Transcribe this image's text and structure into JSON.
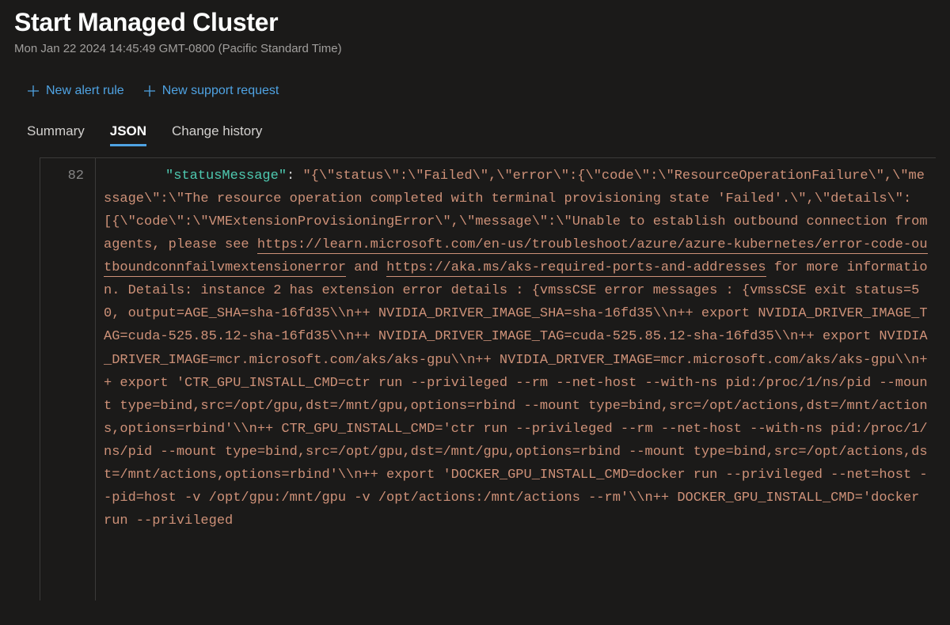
{
  "header": {
    "title": "Start Managed Cluster",
    "subtitle": "Mon Jan 22 2024 14:45:49 GMT-0800 (Pacific Standard Time)"
  },
  "commands": {
    "new_alert_rule": "New alert rule",
    "new_support_request": "New support request"
  },
  "tabs": {
    "summary": "Summary",
    "json": "JSON",
    "change_history": "Change history"
  },
  "json_view": {
    "line_number": "82",
    "key_label": "\"statusMessage\"",
    "value_prefix": ": ",
    "value_part1": "\"{\\\"status\\\":\\\"Failed\\\",\\\"error\\\":{\\\"code\\\":\\\"ResourceOperationFailure\\\",\\\"message\\\":\\\"The resource operation completed with terminal provisioning state 'Failed'.\\\",\\\"details\\\":[{\\\"code\\\":\\\"VMExtensionProvisioningError\\\",\\\"message\\\":\\\"Unable to establish outbound connection from agents, please see ",
    "link1_text": "https://learn.microsoft.com/en-us/troubleshoot/azure/azure-kubernetes/error-code-outboundconnfailvmextensionerror",
    "mid1": " and ",
    "link2_text": "https://aka.ms/aks-required-ports-and-addresses",
    "value_part2": " for more information. Details: instance 2 has extension error details : {vmssCSE error messages : {vmssCSE exit status=50, output=AGE_SHA=sha-16fd35\\\\n++ NVIDIA_DRIVER_IMAGE_SHA=sha-16fd35\\\\n++ export NVIDIA_DRIVER_IMAGE_TAG=cuda-525.85.12-sha-16fd35\\\\n++ NVIDIA_DRIVER_IMAGE_TAG=cuda-525.85.12-sha-16fd35\\\\n++ export NVIDIA_DRIVER_IMAGE=mcr.microsoft.com/aks/aks-gpu\\\\n++ NVIDIA_DRIVER_IMAGE=mcr.microsoft.com/aks/aks-gpu\\\\n++ export 'CTR_GPU_INSTALL_CMD=ctr run --privileged --rm --net-host --with-ns pid:/proc/1/ns/pid --mount type=bind,src=/opt/gpu,dst=/mnt/gpu,options=rbind --mount type=bind,src=/opt/actions,dst=/mnt/actions,options=rbind'\\\\n++ CTR_GPU_INSTALL_CMD='ctr run --privileged --rm --net-host --with-ns pid:/proc/1/ns/pid --mount type=bind,src=/opt/gpu,dst=/mnt/gpu,options=rbind --mount type=bind,src=/opt/actions,dst=/mnt/actions,options=rbind'\\\\n++ export 'DOCKER_GPU_INSTALL_CMD=docker run --privileged --net=host --pid=host -v /opt/gpu:/mnt/gpu -v /opt/actions:/mnt/actions --rm'\\\\n++ DOCKER_GPU_INSTALL_CMD='docker run --privileged"
  }
}
